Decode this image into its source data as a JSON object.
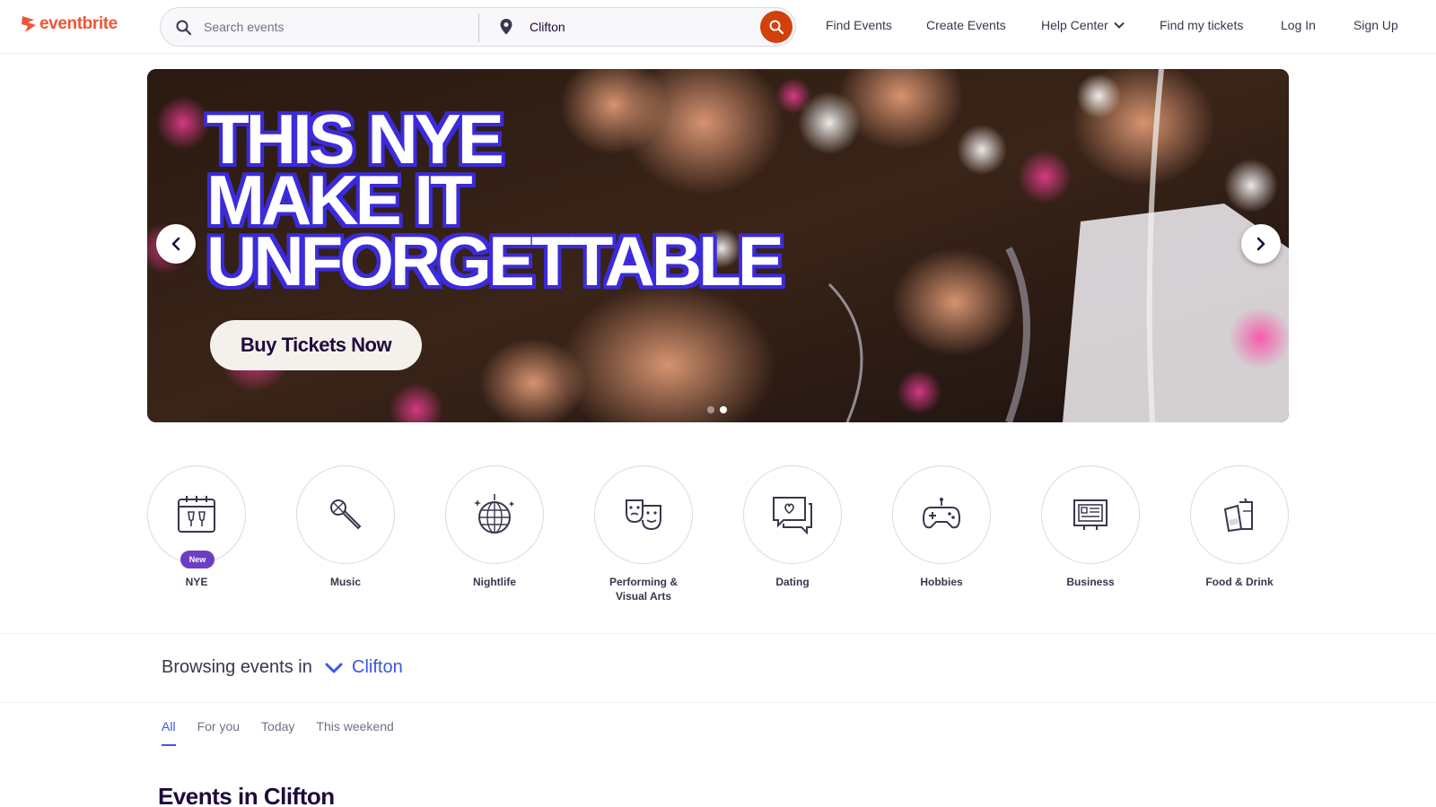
{
  "header": {
    "logo_text": "eventbrite",
    "search_placeholder": "Search events",
    "location_value": "Clifton",
    "nav": {
      "find_events": "Find Events",
      "create_events": "Create Events",
      "help_center": "Help Center",
      "find_tickets": "Find my tickets",
      "log_in": "Log In",
      "sign_up": "Sign Up"
    },
    "brand_color": "#f05537",
    "search_button_color": "#d1410c"
  },
  "hero": {
    "headline": [
      "THIS NYE",
      "MAKE IT",
      "UNFORGETTABLE"
    ],
    "cta_label": "Buy Tickets Now",
    "headline_color": "#3b2bdb",
    "slides": 2,
    "active_slide": 2
  },
  "categories": [
    {
      "label": "NYE",
      "icon": "calendar-champagne-icon",
      "badge": "New"
    },
    {
      "label": "Music",
      "icon": "microphone-icon"
    },
    {
      "label": "Nightlife",
      "icon": "disco-ball-icon"
    },
    {
      "label": "Performing & Visual Arts",
      "icon": "theater-masks-icon"
    },
    {
      "label": "Dating",
      "icon": "chat-heart-icon"
    },
    {
      "label": "Hobbies",
      "icon": "gamepad-icon"
    },
    {
      "label": "Business",
      "icon": "presentation-board-icon"
    },
    {
      "label": "Food & Drink",
      "icon": "drinks-icon"
    }
  ],
  "browse": {
    "label": "Browsing events in",
    "location": "Clifton",
    "accent_color": "#3659e3"
  },
  "tabs": [
    {
      "label": "All",
      "active": true
    },
    {
      "label": "For you",
      "active": false
    },
    {
      "label": "Today",
      "active": false
    },
    {
      "label": "This weekend",
      "active": false
    }
  ],
  "events_section": {
    "title": "Events in Clifton"
  }
}
